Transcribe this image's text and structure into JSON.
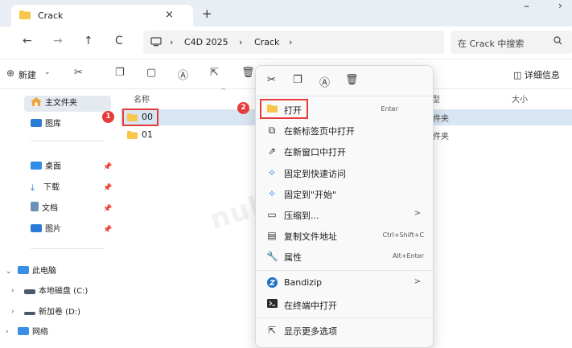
{
  "tab": {
    "title": "Crack",
    "close": "×",
    "new": "+"
  },
  "window": {
    "minimize": "–",
    "edge": "›"
  },
  "nav": {
    "back": "←",
    "forward": "→",
    "up": "↑",
    "refresh": "C",
    "pc_icon": "computer-icon",
    "sep": "›"
  },
  "breadcrumb": [
    "C4D 2025",
    "Crack"
  ],
  "search": {
    "placeholder": "在 Crack 中搜索",
    "icon": "search-icon"
  },
  "toolbar": {
    "new_label": "新建",
    "details_label": "详细信息"
  },
  "sidebar": {
    "home": "主文件夹",
    "gallery": "图库",
    "desktop": "桌面",
    "downloads": "下载",
    "documents": "文档",
    "pictures": "图片",
    "thispc": "此电脑",
    "drive_c": "本地磁盘 (C:)",
    "drive_d": "新加卷 (D:)",
    "network": "网络"
  },
  "filelist": {
    "col_name": "名称",
    "col_type": "型",
    "col_size": "大小",
    "rows": [
      {
        "name": "00",
        "type": "件夹"
      },
      {
        "name": "01",
        "type": "件夹"
      }
    ]
  },
  "badges": {
    "one": "1",
    "two": "2"
  },
  "menu": {
    "open": {
      "label": "打开",
      "shortcut": "Enter"
    },
    "open_new_tab": "在新标签页中打开",
    "open_new_window": "在新窗口中打开",
    "pin_quick": "固定到快速访问",
    "pin_start": "固定到\"开始\"",
    "compress": "压缩到...",
    "copy_path": {
      "label": "复制文件地址",
      "shortcut": "Ctrl+Shift+C"
    },
    "properties": {
      "label": "属性",
      "shortcut": "Alt+Enter"
    },
    "bandizip": "Bandizip",
    "terminal": "在终端中打开",
    "more": "显示更多选项",
    "submenu_arrow": ">"
  },
  "watermark": "nullterminator",
  "colors": {
    "accent": "#0067c0",
    "highlight": "#e53b3b",
    "folder": "#f8c64a",
    "selected_row": "#d8e5f2"
  }
}
